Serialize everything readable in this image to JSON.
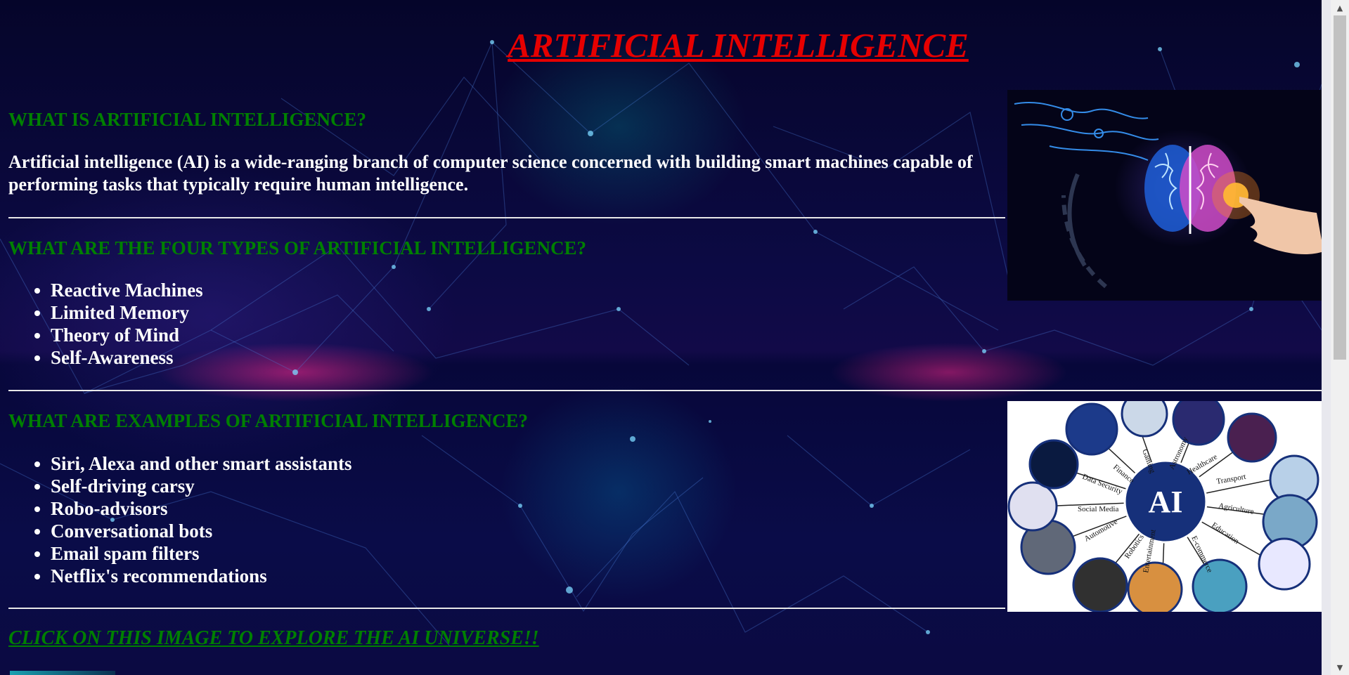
{
  "page": {
    "title": "ARTIFICIAL INTELLIGENCE"
  },
  "section_what": {
    "heading": "WHAT IS ARTIFICIAL INTELLIGENCE?",
    "text": "Artificial intelligence (AI) is a wide-ranging branch of computer science concerned with building smart machines capable of performing tasks that typically require human intelligence."
  },
  "section_types": {
    "heading": "WHAT ARE THE FOUR TYPES OF ARTIFICIAL INTELLIGENCE?",
    "items": [
      "Reactive Machines",
      "Limited Memory",
      "Theory of Mind",
      "Self-Awareness"
    ]
  },
  "section_examples": {
    "heading": "WHAT ARE EXAMPLES OF ARTIFICIAL INTELLIGENCE?",
    "items": [
      "Siri, Alexa and other smart assistants",
      "Self-driving carsy",
      "Robo-advisors",
      "Conversational bots",
      "Email spam filters",
      "Netflix's recommendations"
    ]
  },
  "explore_link": "CLICK ON THIS IMAGE TO EXPLORE THE AI UNIVERSE!!",
  "ai_diagram": {
    "center": "AI",
    "labels": [
      "Finance",
      "Gaming",
      "Astronomy",
      "Healthcare",
      "Transport",
      "Agriculture",
      "Education",
      "E-commerce",
      "Entertainment",
      "Robotics",
      "Automotive",
      "Social Media",
      "Data Security"
    ]
  },
  "colors": {
    "title": "#e60000",
    "heading": "#008000",
    "text": "#ffffff",
    "background": "#07052e"
  },
  "icons": {
    "scroll_up": "triangle-up-icon",
    "scroll_down": "triangle-down-icon"
  }
}
